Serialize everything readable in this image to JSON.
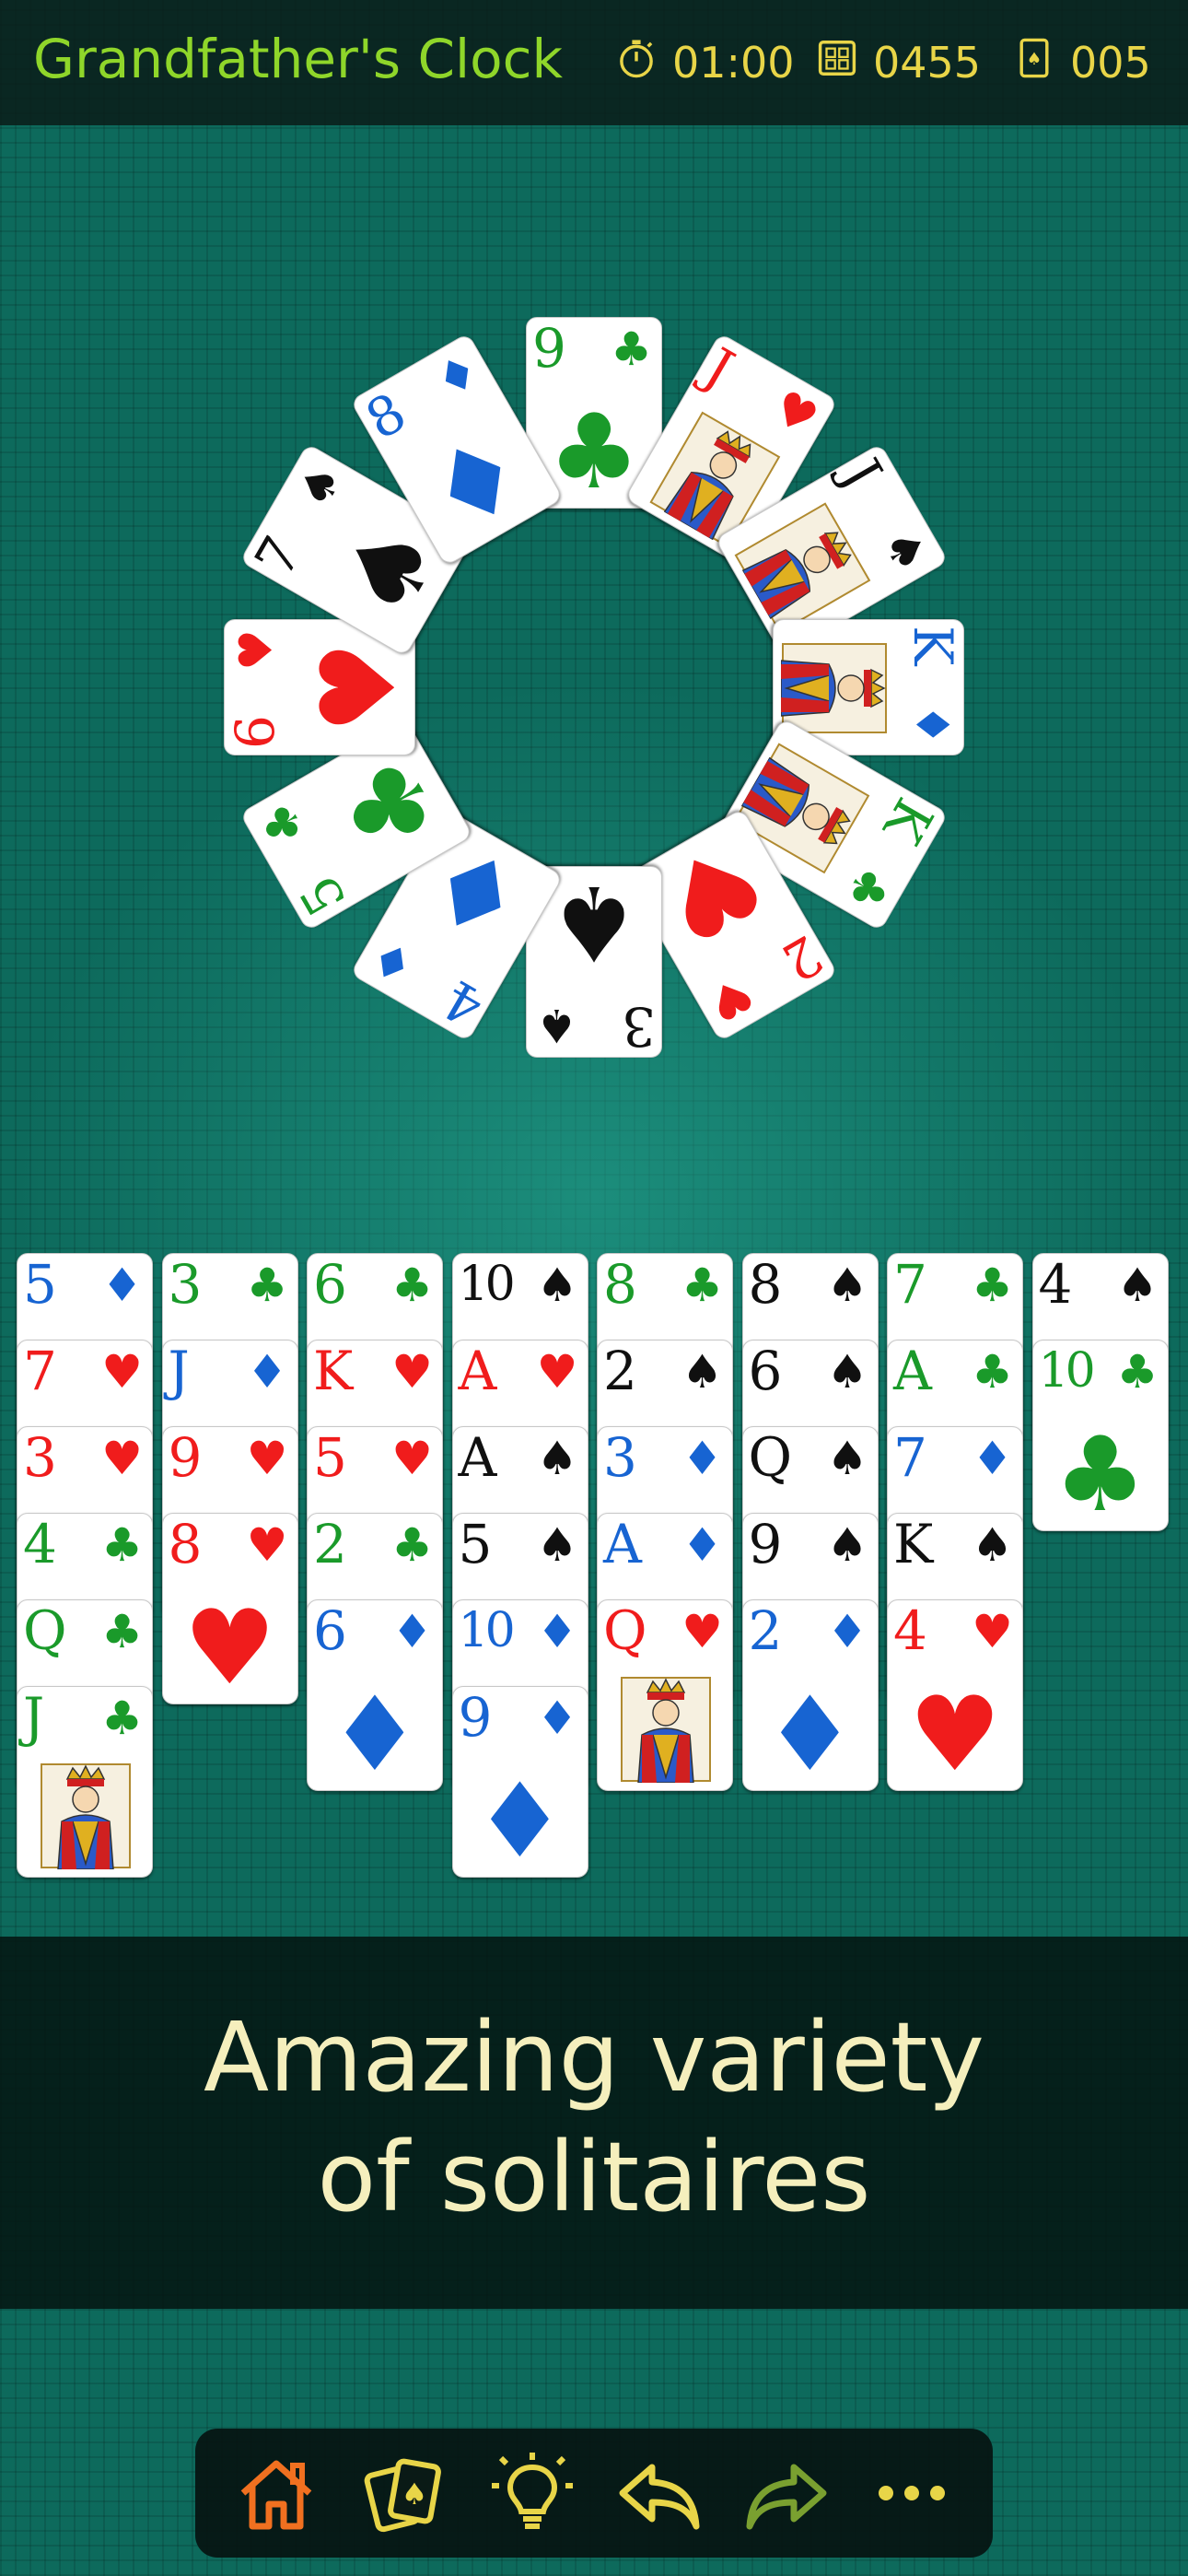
{
  "header": {
    "title": "Grandfather's Clock",
    "timer": "01:00",
    "score": "0455",
    "moves": "005",
    "colors": {
      "title": "#8fd62a",
      "stats": "#e8d548"
    }
  },
  "clock_cards": [
    {
      "rank": "9",
      "suit": "♣",
      "color": "green",
      "face": false
    },
    {
      "rank": "J",
      "suit": "♥",
      "color": "red",
      "face": true
    },
    {
      "rank": "J",
      "suit": "♠",
      "color": "black",
      "face": true
    },
    {
      "rank": "K",
      "suit": "♦",
      "color": "blue",
      "face": true
    },
    {
      "rank": "K",
      "suit": "♣",
      "color": "green",
      "face": true
    },
    {
      "rank": "2",
      "suit": "♥",
      "color": "red",
      "face": false
    },
    {
      "rank": "3",
      "suit": "♠",
      "color": "black",
      "face": false
    },
    {
      "rank": "4",
      "suit": "♦",
      "color": "blue",
      "face": false
    },
    {
      "rank": "5",
      "suit": "♣",
      "color": "green",
      "face": false
    },
    {
      "rank": "6",
      "suit": "♥",
      "color": "red",
      "face": false
    },
    {
      "rank": "7",
      "suit": "♠",
      "color": "black",
      "face": false
    },
    {
      "rank": "8",
      "suit": "♦",
      "color": "blue",
      "face": false
    }
  ],
  "tableau": [
    [
      {
        "rank": "5",
        "suit": "♦",
        "color": "blue"
      },
      {
        "rank": "7",
        "suit": "♥",
        "color": "red"
      },
      {
        "rank": "3",
        "suit": "♥",
        "color": "red"
      },
      {
        "rank": "4",
        "suit": "♣",
        "color": "green"
      },
      {
        "rank": "Q",
        "suit": "♣",
        "color": "green"
      },
      {
        "rank": "J",
        "suit": "♣",
        "color": "green",
        "face": true
      }
    ],
    [
      {
        "rank": "3",
        "suit": "♣",
        "color": "green"
      },
      {
        "rank": "J",
        "suit": "♦",
        "color": "blue"
      },
      {
        "rank": "9",
        "suit": "♥",
        "color": "red"
      },
      {
        "rank": "8",
        "suit": "♥",
        "color": "red"
      }
    ],
    [
      {
        "rank": "6",
        "suit": "♣",
        "color": "green"
      },
      {
        "rank": "K",
        "suit": "♥",
        "color": "red"
      },
      {
        "rank": "5",
        "suit": "♥",
        "color": "red"
      },
      {
        "rank": "2",
        "suit": "♣",
        "color": "green"
      },
      {
        "rank": "6",
        "suit": "♦",
        "color": "blue"
      }
    ],
    [
      {
        "rank": "10",
        "suit": "♠",
        "color": "black"
      },
      {
        "rank": "A",
        "suit": "♥",
        "color": "red"
      },
      {
        "rank": "A",
        "suit": "♠",
        "color": "black"
      },
      {
        "rank": "5",
        "suit": "♠",
        "color": "black"
      },
      {
        "rank": "10",
        "suit": "♦",
        "color": "blue"
      },
      {
        "rank": "9",
        "suit": "♦",
        "color": "blue"
      }
    ],
    [
      {
        "rank": "8",
        "suit": "♣",
        "color": "green"
      },
      {
        "rank": "2",
        "suit": "♠",
        "color": "black"
      },
      {
        "rank": "3",
        "suit": "♦",
        "color": "blue"
      },
      {
        "rank": "A",
        "suit": "♦",
        "color": "blue"
      },
      {
        "rank": "Q",
        "suit": "♥",
        "color": "red",
        "face": true
      }
    ],
    [
      {
        "rank": "8",
        "suit": "♠",
        "color": "black"
      },
      {
        "rank": "6",
        "suit": "♠",
        "color": "black"
      },
      {
        "rank": "Q",
        "suit": "♠",
        "color": "black"
      },
      {
        "rank": "9",
        "suit": "♠",
        "color": "black"
      },
      {
        "rank": "2",
        "suit": "♦",
        "color": "blue"
      }
    ],
    [
      {
        "rank": "7",
        "suit": "♣",
        "color": "green"
      },
      {
        "rank": "A",
        "suit": "♣",
        "color": "green"
      },
      {
        "rank": "7",
        "suit": "♦",
        "color": "blue"
      },
      {
        "rank": "K",
        "suit": "♠",
        "color": "black"
      },
      {
        "rank": "4",
        "suit": "♥",
        "color": "red"
      }
    ],
    [
      {
        "rank": "4",
        "suit": "♠",
        "color": "black"
      },
      {
        "rank": "10",
        "suit": "♣",
        "color": "green"
      }
    ]
  ],
  "promo": {
    "line1": "Amazing variety",
    "line2": "of solitaires",
    "color": "#f5efbd"
  },
  "toolbar": {
    "items": [
      {
        "name": "home-icon",
        "color": "#f07020"
      },
      {
        "name": "cards-icon",
        "color": "#e8d548"
      },
      {
        "name": "hint-lightbulb-icon",
        "color": "#e8d548"
      },
      {
        "name": "undo-icon",
        "color": "#e8d548"
      },
      {
        "name": "redo-icon",
        "color": "#7aa030"
      },
      {
        "name": "more-icon",
        "color": "#e8d548"
      }
    ]
  }
}
